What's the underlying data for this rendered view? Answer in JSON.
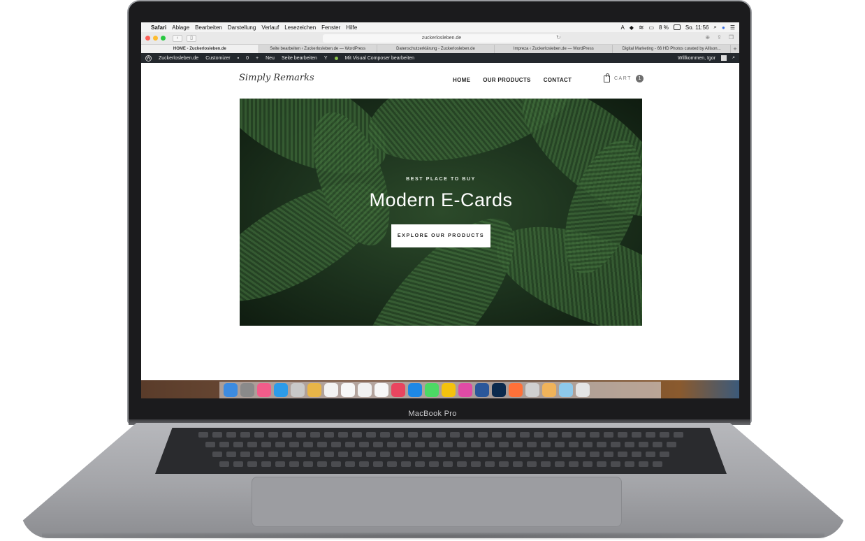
{
  "device": {
    "model_label": "MacBook Pro"
  },
  "menubar": {
    "apple": "",
    "app": "Safari",
    "items": [
      "Ablage",
      "Bearbeiten",
      "Darstellung",
      "Verlauf",
      "Lesezeichen",
      "Fenster",
      "Hilfe"
    ],
    "battery": "8 %",
    "clock": "So. 11:56"
  },
  "browser": {
    "url": "zuckerlosleben.de",
    "tabs": [
      "HOME - Zuckerlosleben.de",
      "Seite bearbeiten ‹ Zuckerlosleben.de — WordPress",
      "Datenschutzerklärung - Zuckerlosleben.de",
      "Impreza ‹ Zuckerlosleben.de — WordPress",
      "Digital Marketing - 66 HD Photos curated by Allison..."
    ],
    "new_tab": "+"
  },
  "adminbar": {
    "site": "Zuckerlosleben.de",
    "customizer": "Customizer",
    "comments": "0",
    "new": "Neu",
    "edit": "Seite bearbeiten",
    "composer": "Mit Visual Composer bearbeiten",
    "welcome": "Willkommen, Igor"
  },
  "site": {
    "logo": "Simply Remarks",
    "nav": [
      "HOME",
      "OUR PRODUCTS",
      "CONTACT"
    ],
    "cart_label": "CART",
    "cart_count": "1",
    "hero": {
      "eyebrow": "BEST PLACE TO BUY",
      "headline": "Modern E-Cards",
      "cta": "EXPLORE OUR PRODUCTS"
    },
    "scroll_top": "^"
  },
  "colors": {
    "accent": "#23282d",
    "hero_green": "#2c4a2a",
    "traffic_red": "#fc5f57",
    "traffic_yellow": "#fdbc2e",
    "traffic_green": "#28c840"
  }
}
